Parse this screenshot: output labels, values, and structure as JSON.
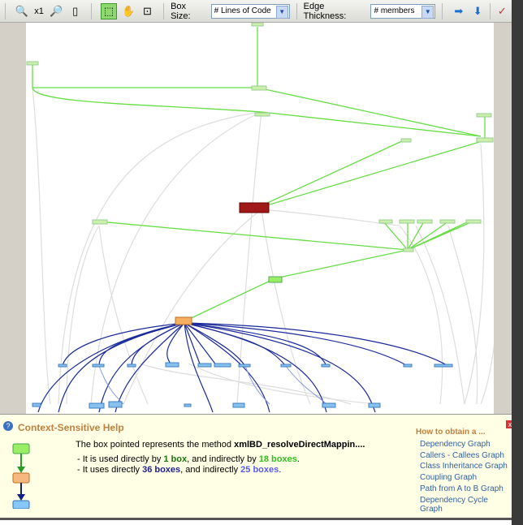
{
  "toolbar": {
    "zoom_level": "x1",
    "box_size_label": "Box Size:",
    "box_size_value": "# Lines of Code",
    "edge_thickness_label": "Edge Thickness:",
    "edge_thickness_value": "# members"
  },
  "help": {
    "title": "Context-Sensitive Help",
    "desc_prefix": "The box pointed represents the method ",
    "method_name": "xmlBD_resolveDirectMappin....",
    "l1_a": "- It is used directly by ",
    "l1_b": "1 box",
    "l1_c": ", and indirectly by ",
    "l1_d": "18 boxes",
    ".": ".",
    "l2_a": "- It uses directly ",
    "l2_b": "36 boxes",
    "l2_c": ", and indirectly ",
    "l2_d": "25 boxes",
    "how_title": "How to obtain a ...",
    "links": [
      "Dependency Graph",
      "Callers - Callees Graph",
      "Class Inheritance Graph",
      "Coupling Graph",
      "Path from A to B Graph",
      "Dependency Cycle Graph"
    ],
    "close": "x"
  },
  "colors": {
    "caller": "#66dd44",
    "selected": "#a01818",
    "callee": "#1a2a9a",
    "pointed": "#f0a040"
  }
}
